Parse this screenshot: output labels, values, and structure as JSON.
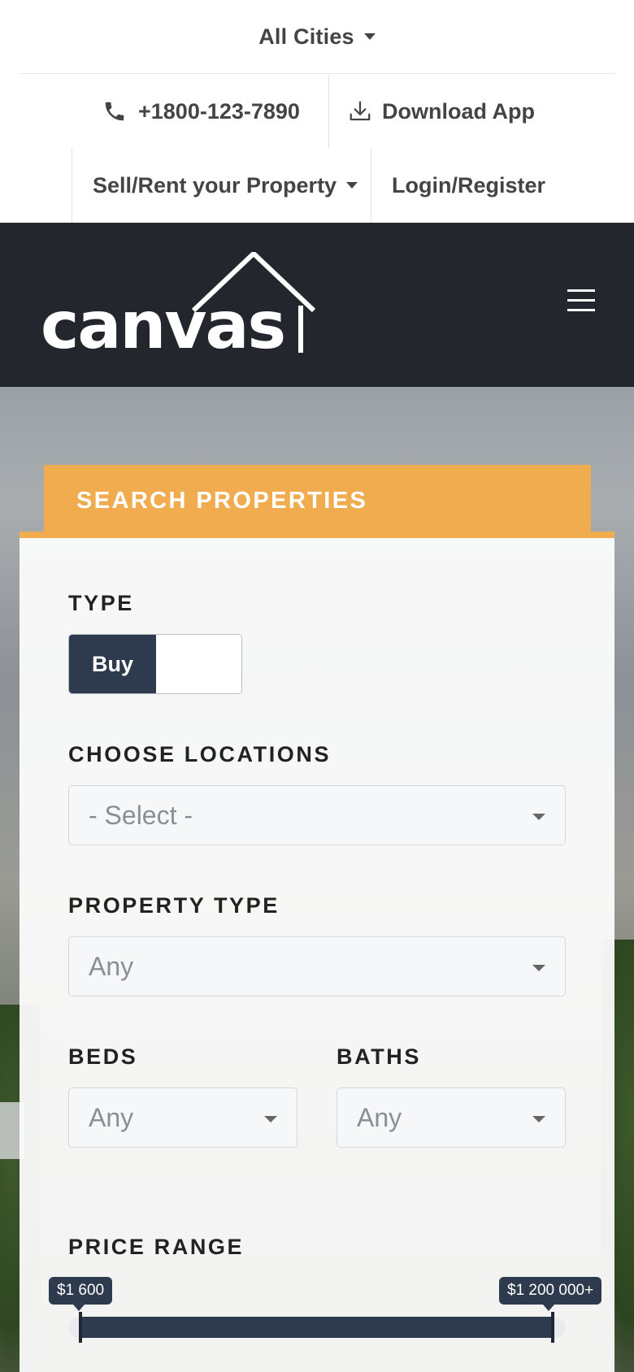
{
  "topbar": {
    "city_selector": "All Cities",
    "phone": "+1800-123-7890",
    "download_app": "Download App",
    "sell_rent": "Sell/Rent your Property",
    "login_register": "Login/Register"
  },
  "header": {
    "logo_text": "canvas"
  },
  "search": {
    "title": "SEARCH PROPERTIES",
    "type_label": "TYPE",
    "type_options": [
      "Buy",
      ""
    ],
    "type_selected": "Buy",
    "locations_label": "CHOOSE LOCATIONS",
    "locations_value": "- Select -",
    "property_type_label": "PROPERTY TYPE",
    "property_type_value": "Any",
    "beds_label": "BEDS",
    "beds_value": "Any",
    "baths_label": "BATHS",
    "baths_value": "Any",
    "price_range_label": "PRICE RANGE",
    "price_min": "$1 600",
    "price_max": "$1 200 000+"
  },
  "colors": {
    "accent": "#f0ac4e",
    "header_bg": "#23272d",
    "button_dark": "#2e3b4e"
  }
}
